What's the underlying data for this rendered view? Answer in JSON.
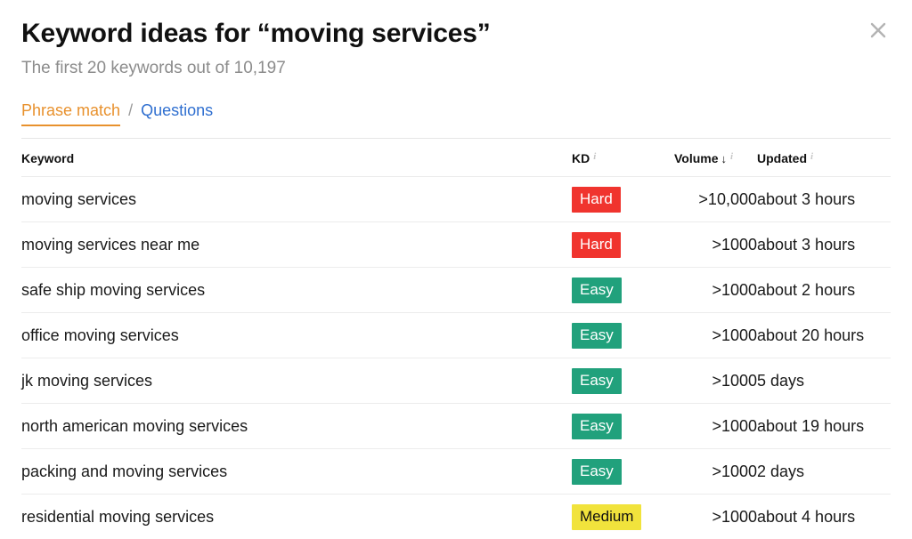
{
  "dialog": {
    "title": "Keyword ideas for “moving services”",
    "subtitle": "The first 20 keywords out of 10,197",
    "close_label": "×"
  },
  "tabs": {
    "active": "Phrase match",
    "separator": "/",
    "other": "Questions"
  },
  "table": {
    "headers": {
      "keyword": "Keyword",
      "kd": "KD",
      "volume": "Volume",
      "volume_sort": "↓",
      "updated": "Updated",
      "info": "i"
    },
    "rows": [
      {
        "keyword": "moving services",
        "kd": "Hard",
        "kd_level": "hard",
        "volume": ">10,000",
        "updated": "about 3 hours"
      },
      {
        "keyword": "moving services near me",
        "kd": "Hard",
        "kd_level": "hard",
        "volume": ">1000",
        "updated": "about 3 hours"
      },
      {
        "keyword": "safe ship moving services",
        "kd": "Easy",
        "kd_level": "easy",
        "volume": ">1000",
        "updated": "about 2 hours"
      },
      {
        "keyword": "office moving services",
        "kd": "Easy",
        "kd_level": "easy",
        "volume": ">1000",
        "updated": "about 20 hours"
      },
      {
        "keyword": "jk moving services",
        "kd": "Easy",
        "kd_level": "easy",
        "volume": ">1000",
        "updated": "5 days"
      },
      {
        "keyword": "north american moving services",
        "kd": "Easy",
        "kd_level": "easy",
        "volume": ">1000",
        "updated": "about 19 hours"
      },
      {
        "keyword": "packing and moving services",
        "kd": "Easy",
        "kd_level": "easy",
        "volume": ">1000",
        "updated": "2 days"
      },
      {
        "keyword": "residential moving services",
        "kd": "Medium",
        "kd_level": "medium",
        "volume": ">1000",
        "updated": "about 4 hours"
      }
    ]
  },
  "colors": {
    "hard": "#f0342e",
    "easy": "#21a17c",
    "medium": "#f1e33c",
    "tab_active": "#e8912d",
    "tab_link": "#2f6fd0",
    "subtitle": "#8c8c8c",
    "row_divider": "#ececec"
  }
}
